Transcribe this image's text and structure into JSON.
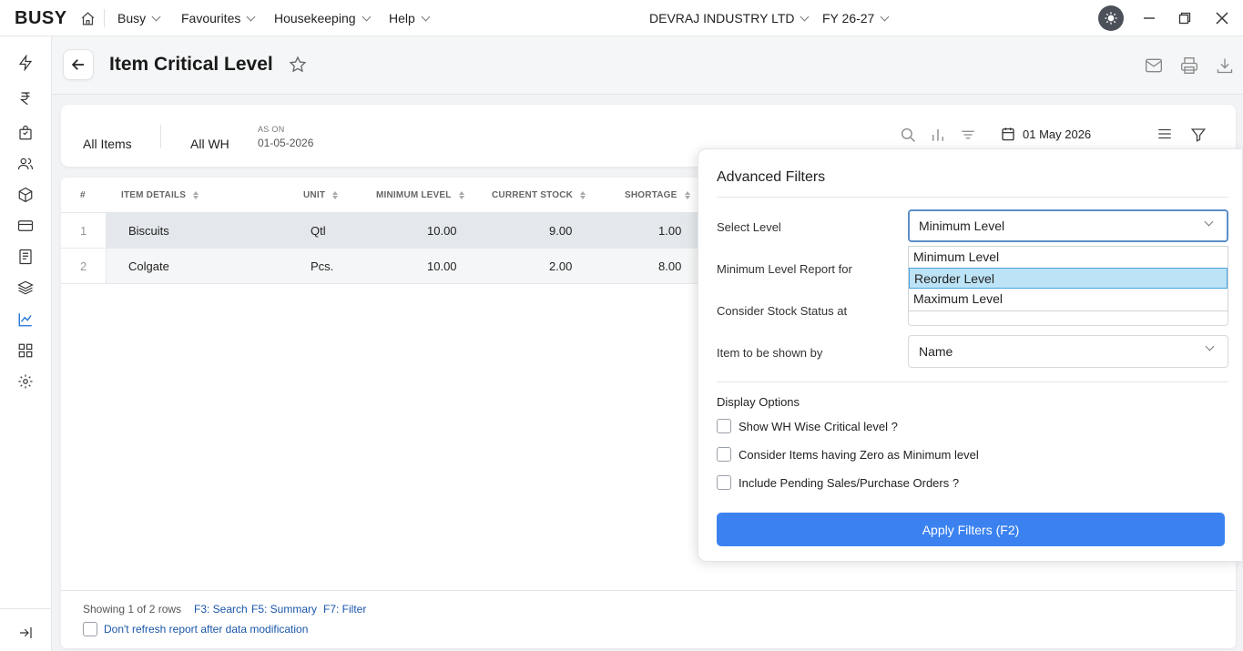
{
  "topbar": {
    "logo": "BUSY",
    "menus": [
      "Busy",
      "Favourites",
      "Housekeeping",
      "Help"
    ],
    "company": "DEVRAJ INDUSTRY LTD",
    "fiscal_year": "FY 26-27"
  },
  "page": {
    "title": "Item Critical Level"
  },
  "filters": {
    "items": "All Items",
    "warehouse": "All WH",
    "as_on_label": "AS ON",
    "as_on_value": "01-05-2026",
    "date": "01 May 2026"
  },
  "table": {
    "headers": [
      "#",
      "ITEM DETAILS",
      "UNIT",
      "MINIMUM LEVEL",
      "CURRENT STOCK",
      "SHORTAGE"
    ],
    "rows": [
      {
        "num": "1",
        "item": "Biscuits",
        "unit": "Qtl",
        "min_level": "10.00",
        "current_stock": "9.00",
        "shortage": "1.00"
      },
      {
        "num": "2",
        "item": "Colgate",
        "unit": "Pcs.",
        "min_level": "10.00",
        "current_stock": "2.00",
        "shortage": "8.00"
      }
    ]
  },
  "footer": {
    "showing": "Showing 1 of 2 rows",
    "shortcut_search": "F3: Search",
    "shortcut_summary": "F5: Summary",
    "shortcut_filter": "F7: Filter",
    "refresh_label": "Don't refresh report after data modification"
  },
  "advanced_filters": {
    "title": "Advanced Filters",
    "select_level_label": "Select Level",
    "select_level_value": "Minimum Level",
    "min_level_report_label": "Minimum Level Report for",
    "stock_status_label": "Consider Stock Status at",
    "item_shown_by_label": "Item to be shown by",
    "item_shown_by_value": "Name",
    "dropdown_options": [
      "Minimum Level",
      "Reorder Level",
      "Maximum Level"
    ],
    "dropdown_highlighted": "Reorder Level",
    "display_options_title": "Display Options",
    "options": [
      "Show WH Wise Critical level ?",
      "Consider Items having Zero as Minimum level",
      "Include Pending Sales/Purchase Orders ?"
    ],
    "apply_button": "Apply Filters (F2)"
  },
  "colors": {
    "primary": "#3b82f0",
    "dropdown_highlight": "#bde3f6",
    "link": "#1a56a8"
  }
}
